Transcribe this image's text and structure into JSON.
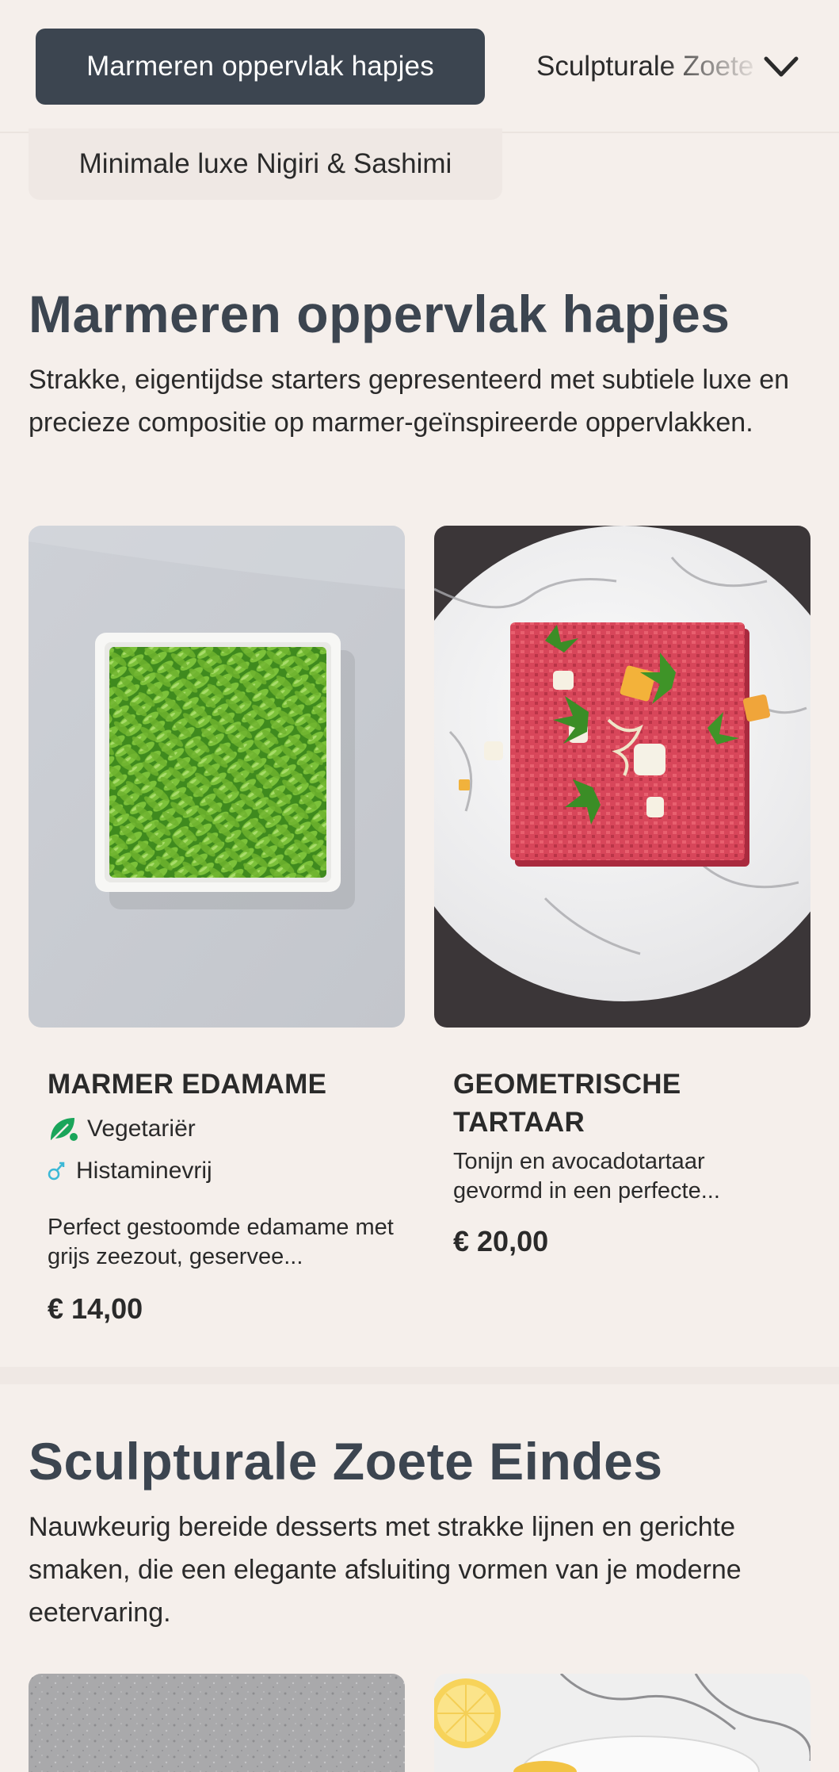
{
  "nav": {
    "active_category": "Marmeren oppervlak hapjes",
    "next_category": "Sculpturale Zoete Eindes",
    "dropdown_item": "Minimale luxe Nigiri & Sashimi",
    "chevron_icon": "chevron-down-icon"
  },
  "sections": [
    {
      "title": "Marmeren oppervlak hapjes",
      "description": "Strakke, eigentijdse starters gepresenteerd met subtiele luxe en precieze compositie op marmer-geïnspireerde oppervlakken.",
      "items": [
        {
          "name": "MARMER EDAMAME",
          "tags": [
            {
              "label": "Vegetariër",
              "icon": "vegetarian-leaf-icon",
              "color": "#1aa55a"
            },
            {
              "label": "Histaminevrij",
              "icon": "histamine-free-icon",
              "color": "#3cb8d6"
            }
          ],
          "description": "Perfect gestoomde edamame met grijs zeezout, geservee...",
          "price": "€ 14,00"
        },
        {
          "name": "GEOMETRISCHE TARTAAR",
          "description": "Tonijn en avocadotartaar gevormd in een perfecte...",
          "price": "€ 20,00"
        }
      ]
    },
    {
      "title": "Sculpturale Zoete Eindes",
      "description": "Nauwkeurig bereide desserts met strakke lijnen en gerichte smaken, die een elegante afsluiting vormen van je moderne eetervaring."
    }
  ],
  "colors": {
    "background": "#f5efeb",
    "accent_dark": "#3c4550"
  }
}
